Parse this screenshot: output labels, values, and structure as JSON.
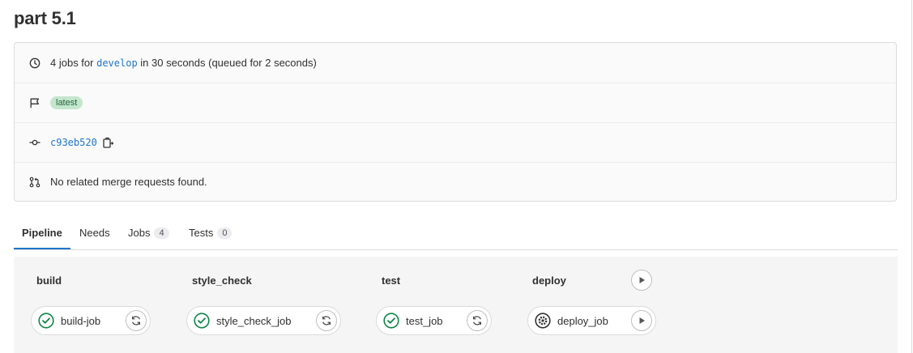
{
  "page": {
    "title": "part 5.1"
  },
  "summary": {
    "jobs_prefix": "4 jobs for ",
    "branch": "develop",
    "duration_text": " in 30 seconds (queued for 2 seconds)",
    "badge": "latest",
    "commit_sha": "c93eb520",
    "merge_requests_text": "No related merge requests found."
  },
  "tabs": [
    {
      "label": "Pipeline",
      "count": null,
      "active": true
    },
    {
      "label": "Needs",
      "count": null
    },
    {
      "label": "Jobs",
      "count": "4"
    },
    {
      "label": "Tests",
      "count": "0"
    }
  ],
  "stages": [
    {
      "name": "build",
      "job": {
        "name": "build-job",
        "status": "passed",
        "action": "retry"
      }
    },
    {
      "name": "style_check",
      "job": {
        "name": "style_check_job",
        "status": "passed",
        "action": "retry"
      }
    },
    {
      "name": "test",
      "job": {
        "name": "test_job",
        "status": "passed",
        "action": "retry"
      }
    },
    {
      "name": "deploy",
      "job": {
        "name": "deploy_job",
        "status": "manual",
        "action": "play"
      },
      "stage_action": "play"
    }
  ],
  "colors": {
    "link": "#1f75cb",
    "success": "#108548",
    "badge_bg": "#c3e6cd",
    "badge_text": "#24663b"
  },
  "icons": {
    "summary": "clock-icon",
    "badge": "flag-icon",
    "commit": "commit-icon",
    "merge": "merge-request-icon"
  }
}
